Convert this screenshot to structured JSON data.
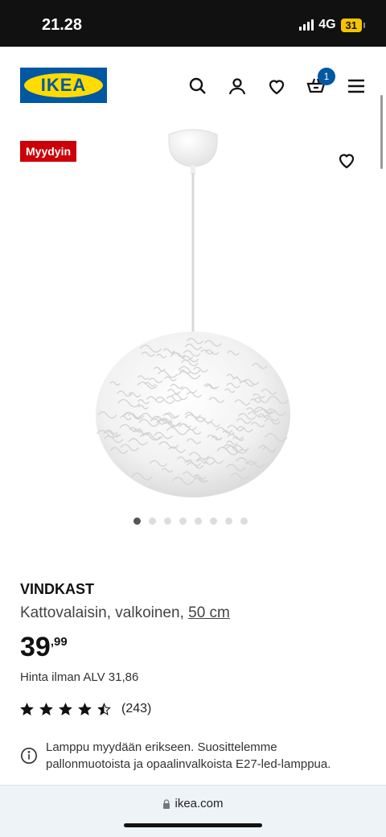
{
  "status_bar": {
    "time": "21.28",
    "network": "4G",
    "battery": "31"
  },
  "header": {
    "logo_text": "IKEA",
    "cart_count": "1",
    "icons": [
      "search-icon",
      "user-icon",
      "heart-icon",
      "cart-icon",
      "menu-icon"
    ]
  },
  "product": {
    "badge": "Myydyin",
    "name": "VINDKAST",
    "description": "Kattovalaisin, valkoinen,",
    "size": "50 cm",
    "price_int": "39",
    "price_dec": ",99",
    "vat_text": "Hinta ilman ALV 31,86",
    "rating": 4.5,
    "rating_count": "(243)",
    "info": "Lamppu myydään erikseen. Suosittelemme pallonmuotoista ja opaalinvalkoista E27-led-lamppua.",
    "image_count": 8,
    "active_image": 1
  },
  "browser": {
    "url": "ikea.com"
  },
  "colors": {
    "ikea_blue": "#0058a3",
    "ikea_yellow": "#ffdb00",
    "badge_red": "#cc0008"
  }
}
